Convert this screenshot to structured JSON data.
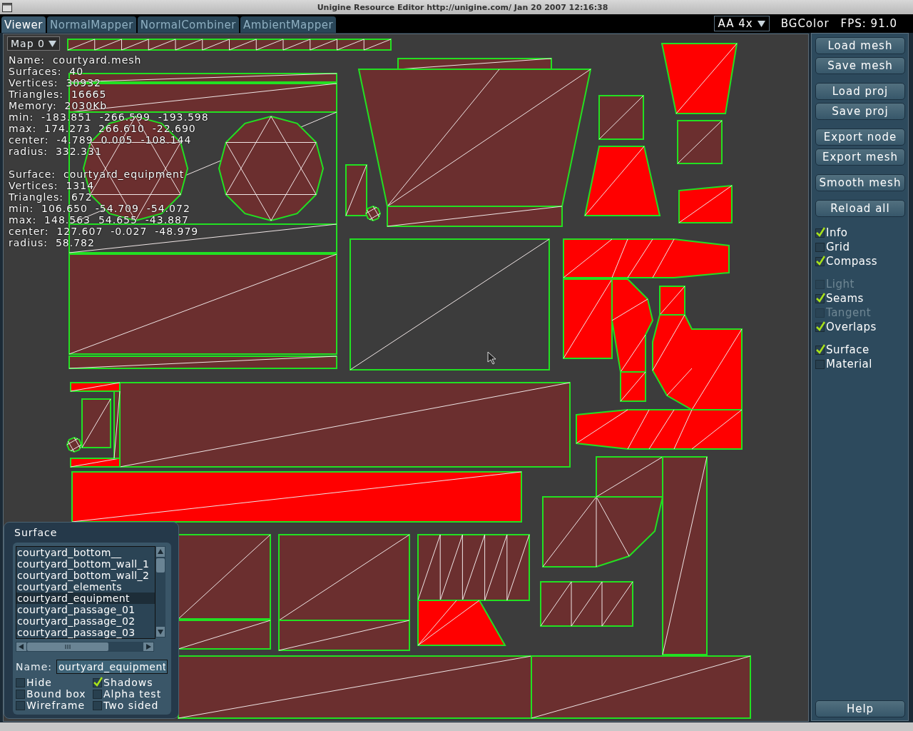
{
  "window": {
    "title": "Unigine Resource Editor http://unigine.com/ Jan 20 2007 12:16:38"
  },
  "tabs": [
    {
      "label": "Viewer",
      "selected": true
    },
    {
      "label": "NormalMapper",
      "selected": false
    },
    {
      "label": "NormalCombiner",
      "selected": false
    },
    {
      "label": "AmbientMapper",
      "selected": false
    }
  ],
  "toolbar": {
    "antialias": "AA  4x",
    "bgcolor": "BGColor",
    "fps": "FPS:  91.0"
  },
  "viewport": {
    "map_select": "Map  0",
    "mesh_info": [
      "Name:  courtyard.mesh",
      "Surfaces:  40",
      "Vertices:  30932",
      "Triangles:  16665",
      "Memory:  2030Kb",
      "min:  -183.851  -266.599  -193.598",
      "max:  174.273  266.610  -22.690",
      "center:  -4.789  0.005  -108.144",
      "radius:  332.331"
    ],
    "surface_info": [
      "Surface:  courtyard_equipment",
      "Vertices:  1314",
      "Triangles:  672",
      "min:  106.650  -54.709  -54.072",
      "max:  148.563  54.655  -43.887",
      "center:  127.607  -0.027  -48.979",
      "radius:  58.782"
    ]
  },
  "side_panel": {
    "button_groups": [
      [
        "Load mesh",
        "Save mesh"
      ],
      [
        "Load proj",
        "Save proj"
      ],
      [
        "Export node",
        "Export mesh"
      ],
      [
        "Smooth mesh"
      ],
      [
        "Reload all"
      ]
    ],
    "checkbox_groups": [
      [
        {
          "label": "Info",
          "checked": true,
          "disabled": false
        },
        {
          "label": "Grid",
          "checked": false,
          "disabled": false
        },
        {
          "label": "Compass",
          "checked": true,
          "disabled": false
        }
      ],
      [
        {
          "label": "Light",
          "checked": false,
          "disabled": true
        },
        {
          "label": "Seams",
          "checked": true,
          "disabled": false
        },
        {
          "label": "Tangent",
          "checked": false,
          "disabled": true
        },
        {
          "label": "Overlaps",
          "checked": true,
          "disabled": false
        }
      ],
      [
        {
          "label": "Surface",
          "checked": true,
          "disabled": false
        },
        {
          "label": "Material",
          "checked": false,
          "disabled": false
        }
      ]
    ],
    "help_button": "Help"
  },
  "surface_panel": {
    "title": "Surface",
    "items": [
      {
        "label": "courtyard_bottom__",
        "selected": false
      },
      {
        "label": "courtyard_bottom_wall_1",
        "selected": false
      },
      {
        "label": "courtyard_bottom_wall_2",
        "selected": false
      },
      {
        "label": "courtyard_elements",
        "selected": false
      },
      {
        "label": "courtyard_equipment",
        "selected": true
      },
      {
        "label": "courtyard_passage_01",
        "selected": false
      },
      {
        "label": "courtyard_passage_02",
        "selected": false
      },
      {
        "label": "courtyard_passage_03",
        "selected": false
      }
    ],
    "name_label": "Name:",
    "name_value": "ourtyard_equipment",
    "checkboxes": [
      {
        "label": "Hide",
        "checked": false
      },
      {
        "label": "Shadows",
        "checked": true
      },
      {
        "label": "Bound box",
        "checked": false
      },
      {
        "label": "Alpha test",
        "checked": false
      },
      {
        "label": "Wireframe",
        "checked": false
      },
      {
        "label": "Two sided",
        "checked": false
      }
    ]
  }
}
